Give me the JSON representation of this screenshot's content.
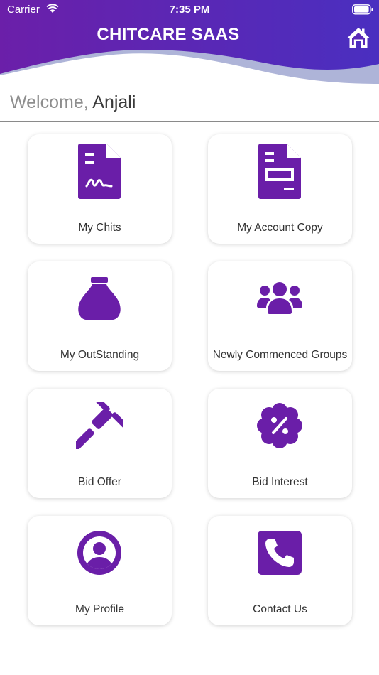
{
  "status_bar": {
    "carrier": "Carrier",
    "time": "7:35 PM"
  },
  "header": {
    "title": "CHITCARE SAAS",
    "home_icon": "home-icon"
  },
  "colors": {
    "brand_purple": "#6A1EA8",
    "header_start": "#6B1FA9",
    "header_end": "#4A2FC0",
    "wave": "#AEB4D8"
  },
  "welcome": {
    "prefix": "Welcome,",
    "name": "Anjali"
  },
  "tiles": [
    {
      "label": "My Chits",
      "icon": "signed-document-icon"
    },
    {
      "label": "My Account Copy",
      "icon": "invoice-document-icon"
    },
    {
      "label": "My OutStanding",
      "icon": "money-bag-icon"
    },
    {
      "label": "Newly Commenced Groups",
      "icon": "users-group-icon"
    },
    {
      "label": "Bid Offer",
      "icon": "gavel-icon"
    },
    {
      "label": "Bid Interest",
      "icon": "percent-badge-icon"
    },
    {
      "label": "My Profile",
      "icon": "user-circle-icon"
    },
    {
      "label": "Contact Us",
      "icon": "phone-square-icon"
    }
  ]
}
